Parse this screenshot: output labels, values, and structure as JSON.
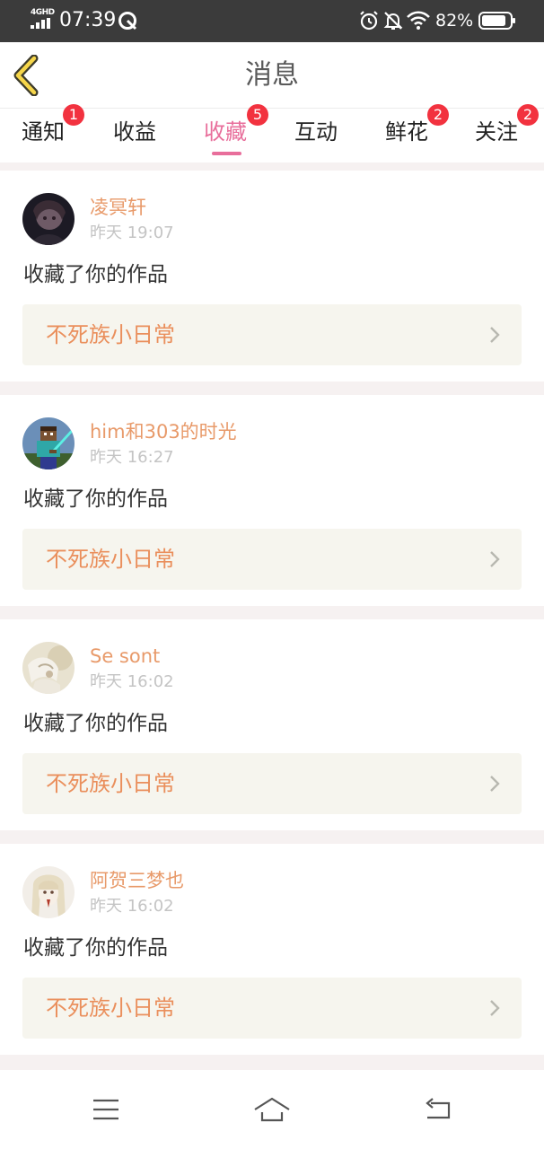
{
  "status_bar": {
    "network": "4GHD",
    "time": "07:39",
    "battery": "82%",
    "icons": [
      "signal-icon",
      "app-notification-icon",
      "alarm-icon",
      "bell-mute-icon",
      "wifi-icon",
      "battery-icon"
    ]
  },
  "header": {
    "title": "消息",
    "back_icon": "chevron-left-icon"
  },
  "tabs": [
    {
      "label": "通知",
      "badge": "1",
      "active": false
    },
    {
      "label": "收益",
      "badge": "",
      "active": false
    },
    {
      "label": "收藏",
      "badge": "5",
      "active": true
    },
    {
      "label": "互动",
      "badge": "",
      "active": false
    },
    {
      "label": "鲜花",
      "badge": "2",
      "active": false
    },
    {
      "label": "关注",
      "badge": "2",
      "active": false
    }
  ],
  "items": [
    {
      "username": "凌冥轩",
      "time": "昨天 19:07",
      "action": "收藏了你的作品",
      "work": "不死族小日常"
    },
    {
      "username": "him和303的时光",
      "time": "昨天 16:27",
      "action": "收藏了你的作品",
      "work": "不死族小日常"
    },
    {
      "username": "Se sont",
      "time": "昨天 16:02",
      "action": "收藏了你的作品",
      "work": "不死族小日常"
    },
    {
      "username": "阿贺三梦也",
      "time": "昨天 16:02",
      "action": "收藏了你的作品",
      "work": "不死族小日常"
    }
  ],
  "nav_bar": {
    "icons": [
      "menu-icon",
      "home-icon",
      "back-icon"
    ]
  },
  "colors": {
    "accent": "#e86e9b",
    "badge": "#f2323f",
    "username": "#e89a6a",
    "work_title": "#ea8f5c",
    "status_bar": "#3b3b3b"
  }
}
